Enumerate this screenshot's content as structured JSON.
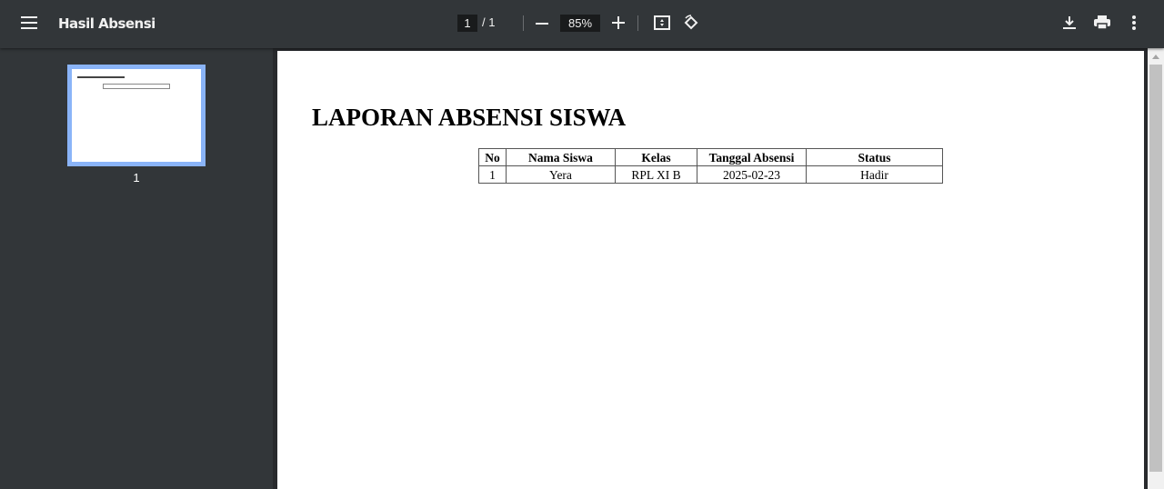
{
  "toolbar": {
    "title": "Hasil Absensi",
    "current_page": "1",
    "page_total": "/ 1",
    "zoom": "85%"
  },
  "sidebar": {
    "thumbnail_label": "1"
  },
  "document": {
    "title": "LAPORAN ABSENSI SISWA",
    "headers": [
      "No",
      "Nama Siswa",
      "Kelas",
      "Tanggal Absensi",
      "Status"
    ],
    "rows": [
      [
        "1",
        "Yera",
        "RPL XI B",
        "2025-02-23",
        "Hadir"
      ]
    ]
  }
}
